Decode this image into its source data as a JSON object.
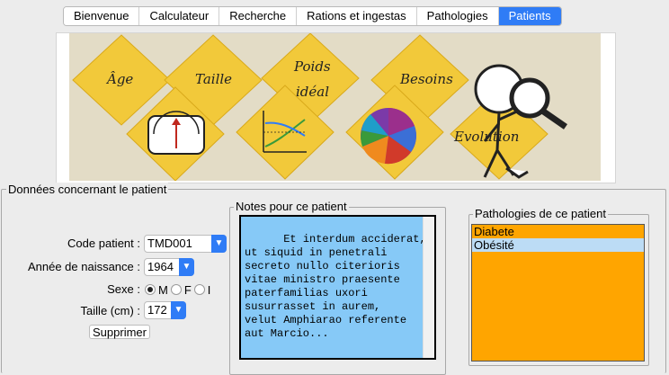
{
  "tabs": [
    {
      "label": "Bienvenue",
      "active": false
    },
    {
      "label": "Calculateur",
      "active": false
    },
    {
      "label": "Recherche",
      "active": false
    },
    {
      "label": "Rations et ingestas",
      "active": false
    },
    {
      "label": "Pathologies",
      "active": false
    },
    {
      "label": "Patients",
      "active": true
    }
  ],
  "banner": {
    "age": "Âge",
    "taille": "Taille",
    "poids": "Poids",
    "ideal": "idéal",
    "besoins": "Besoins",
    "evolution": "Evolution"
  },
  "patient": {
    "legend": "Données concernant le patient",
    "code_label": "Code patient :",
    "code_value": "TMD001",
    "annee_label": "Année de naissance :",
    "annee_value": "1964",
    "sexe_label": "Sexe :",
    "sexe_options": [
      "M",
      "F",
      "I"
    ],
    "sexe_selected": "M",
    "taille_label": "Taille (cm) :",
    "taille_value": "172",
    "delete_label": "Supprimer"
  },
  "notes": {
    "legend": "Notes pour ce patient",
    "text": "Et interdum acciderat,\nut siquid in penetrali\nsecreto nullo citerioris\nvitae ministro praesente\npaterfamilias uxori\nsusurrasset in aurem,\nvelut Amphiarao referente\naut Marcio..."
  },
  "pathologies": {
    "legend": "Pathologies de ce patient",
    "items": [
      {
        "label": "Diabete",
        "selected": false
      },
      {
        "label": "Obésité",
        "selected": true
      }
    ]
  },
  "colors": {
    "accent": "#2f7cf6",
    "notes_bg": "#86c9f7",
    "pathologies_bg": "#ffa500",
    "diamond": "#f2c93a"
  }
}
